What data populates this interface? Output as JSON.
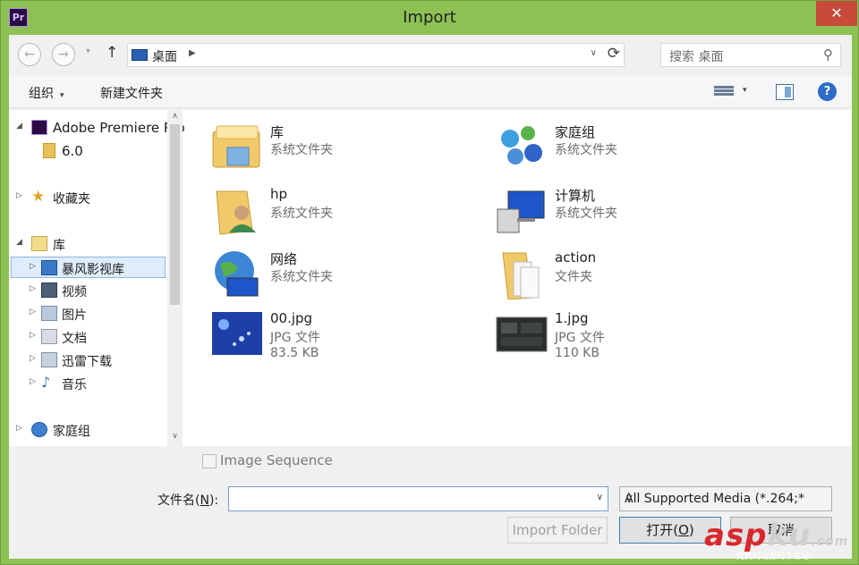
{
  "window": {
    "title": "Import",
    "app_badge": "Pr",
    "close_glyph": "✕"
  },
  "address": {
    "back_glyph": "←",
    "forward_glyph": "→",
    "history_glyph": "▾",
    "up_glyph": "↑",
    "path": "桌面",
    "separator_glyph": "▶",
    "dropdown_glyph": "∨",
    "refresh_glyph": "⟳",
    "search_placeholder": "搜索 桌面",
    "search_glyph": "⚲"
  },
  "toolbar": {
    "organize": "组织",
    "organize_caret": "▾",
    "new_folder": "新建文件夹",
    "view_caret": "▾",
    "help_glyph": "?"
  },
  "nav": [
    {
      "label": "Adobe Premiere Pro",
      "icon": "premiere-icon"
    },
    {
      "label": "6.0",
      "icon": "folder-icon"
    },
    {
      "label": "收藏夹",
      "icon": "star-icon"
    },
    {
      "label": "库",
      "icon": "library-icon"
    },
    {
      "label": "暴风影视库",
      "icon": "video-library-icon"
    },
    {
      "label": "视频",
      "icon": "video-icon"
    },
    {
      "label": "图片",
      "icon": "pictures-icon"
    },
    {
      "label": "文档",
      "icon": "documents-icon"
    },
    {
      "label": "迅雷下载",
      "icon": "download-icon"
    },
    {
      "label": "音乐",
      "icon": "music-icon"
    },
    {
      "label": "家庭组",
      "icon": "homegroup-icon"
    }
  ],
  "nav_glyphs": {
    "expanded": "◢",
    "collapsed": "▷",
    "scroll_up": "∧",
    "scroll_down": "∨"
  },
  "files": [
    {
      "name": "库",
      "type": "系统文件夹",
      "size": "",
      "icon": "library-folder-icon"
    },
    {
      "name": "家庭组",
      "type": "系统文件夹",
      "size": "",
      "icon": "homegroup-icon"
    },
    {
      "name": "hp",
      "type": "系统文件夹",
      "size": "",
      "icon": "user-folder-icon"
    },
    {
      "name": "计算机",
      "type": "系统文件夹",
      "size": "",
      "icon": "computer-icon"
    },
    {
      "name": "网络",
      "type": "系统文件夹",
      "size": "",
      "icon": "network-icon"
    },
    {
      "name": "action",
      "type": "文件夹",
      "size": "",
      "icon": "folder-icon"
    },
    {
      "name": "00.jpg",
      "type": "JPG 文件",
      "size": "83.5 KB",
      "icon": "image-thumbnail"
    },
    {
      "name": "1.jpg",
      "type": "JPG 文件",
      "size": "110 KB",
      "icon": "image-thumbnail"
    }
  ],
  "bottom": {
    "image_sequence_label": "Image Sequence",
    "filename_label_pre": "文件名(",
    "filename_label_key": "N",
    "filename_label_post": "):",
    "filename_value": "",
    "filename_dropdown_glyph": "∨",
    "file_type": "All Supported Media (*.264;*",
    "file_type_dropdown_glyph": "∨",
    "import_folder": "Import Folder",
    "open_pre": "打开(",
    "open_key": "O",
    "open_post": ")",
    "cancel": "取消"
  },
  "watermark": {
    "main": "asp",
    "tail": "ku",
    "suffix": ".com",
    "sub": "免费网站源码下载站!"
  },
  "colors": {
    "frame": "#8ec154",
    "selection": "#dfecfb",
    "close": "#c74a3a",
    "watermark": "#d8282e"
  }
}
